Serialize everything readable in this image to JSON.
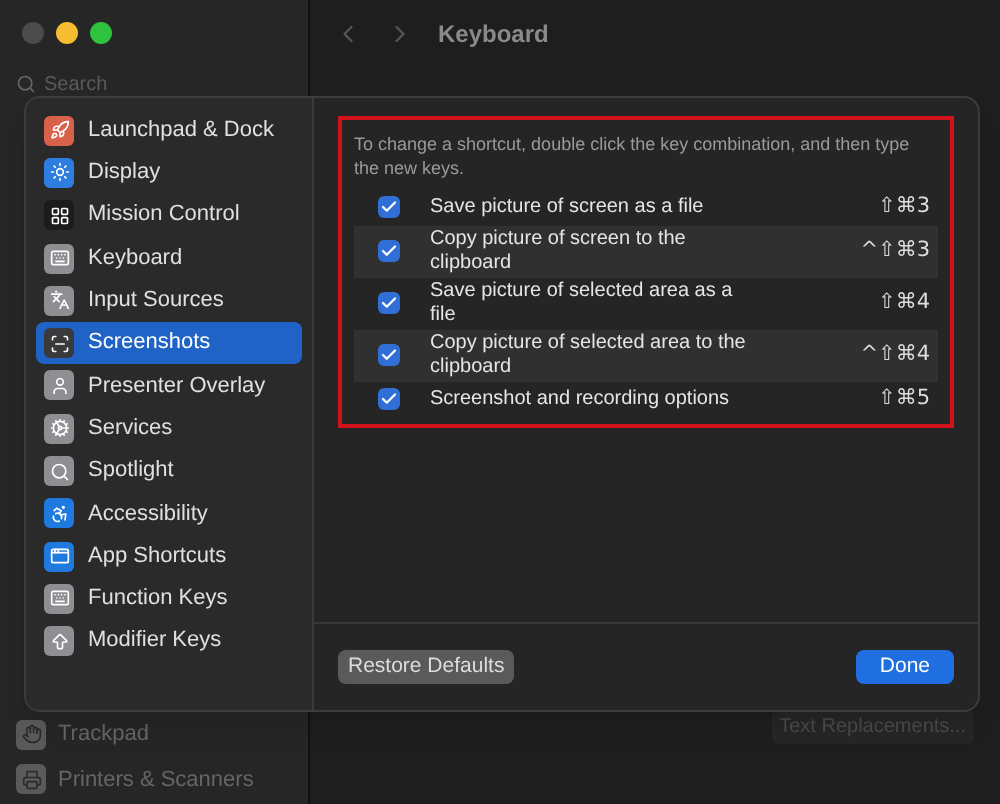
{
  "window": {
    "title": "Keyboard",
    "search": {
      "placeholder": "Search"
    },
    "sidebar_items": [
      {
        "label": "Trackpad",
        "color": "#5a5a5a"
      },
      {
        "label": "Printers & Scanners",
        "color": "#5a5a5a"
      }
    ],
    "text_replacements_button": "Text Replacements..."
  },
  "sheet": {
    "categories": [
      {
        "label": "Launchpad & Dock",
        "color": "#d9614c",
        "selected": false
      },
      {
        "label": "Display",
        "color": "#2f7de1",
        "selected": false
      },
      {
        "label": "Mission Control",
        "color": "#1c1c1c",
        "selected": false
      },
      {
        "label": "Keyboard",
        "color": "#8e8e93",
        "selected": false
      },
      {
        "label": "Input Sources",
        "color": "#8e8e93",
        "selected": false
      },
      {
        "label": "Screenshots",
        "color": "#3a3a3c",
        "selected": true
      },
      {
        "label": "Presenter Overlay",
        "color": "#8e8e93",
        "selected": false
      },
      {
        "label": "Services",
        "color": "#8e8e93",
        "selected": false
      },
      {
        "label": "Spotlight",
        "color": "#8e8e93",
        "selected": false
      },
      {
        "label": "Accessibility",
        "color": "#1f7ae0",
        "selected": false
      },
      {
        "label": "App Shortcuts",
        "color": "#1f7ae0",
        "selected": false
      },
      {
        "label": "Function Keys",
        "color": "#8e8e93",
        "selected": false
      },
      {
        "label": "Modifier Keys",
        "color": "#8e8e93",
        "selected": false
      }
    ],
    "hint": "To change a shortcut, double click the key combination, and then type the new keys.",
    "shortcuts": [
      {
        "label": "Save picture of screen as a file",
        "keys": "⇧⌘3",
        "checked": true
      },
      {
        "label": "Copy picture of screen to the clipboard",
        "keys": "^⇧⌘3",
        "checked": true
      },
      {
        "label": "Save picture of selected area as a file",
        "keys": "⇧⌘4",
        "checked": true
      },
      {
        "label": "Copy picture of selected area to the clipboard",
        "keys": "^⇧⌘4",
        "checked": true
      },
      {
        "label": "Screenshot and recording options",
        "keys": "⇧⌘5",
        "checked": true
      }
    ],
    "restore_button": "Restore Defaults",
    "done_button": "Done"
  }
}
